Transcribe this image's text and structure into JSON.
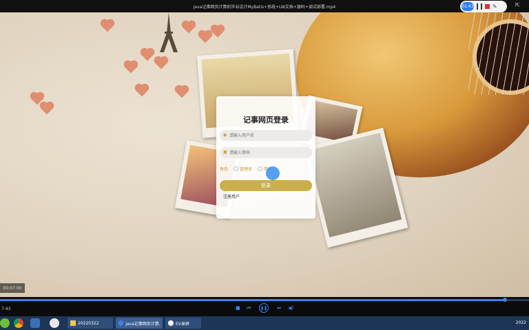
{
  "window": {
    "title": "java记事网页计算机毕业设计MyBatis+系统+LW文档+源码+调试部署.mp4"
  },
  "recorder": {
    "time": "01:43"
  },
  "login": {
    "heading": "记事网页登录",
    "username_placeholder": "请输入用户名",
    "password_placeholder": "请输入密码",
    "role_label": "角色",
    "roles": [
      "管理员",
      "用户"
    ],
    "login_button": "登录",
    "register_link": "注册用户"
  },
  "video": {
    "timestamp": "00:07:00",
    "current_time": "7:43",
    "progress": 0.955
  },
  "taskbar": {
    "items": [
      {
        "label": "20220322"
      },
      {
        "label": "java记事网页计算..."
      },
      {
        "label": "EV录屏"
      }
    ],
    "clock": "2022"
  },
  "colors": {
    "accent": "#c9b04d",
    "player_blue": "#3c82f0",
    "record_red": "#e03030"
  }
}
